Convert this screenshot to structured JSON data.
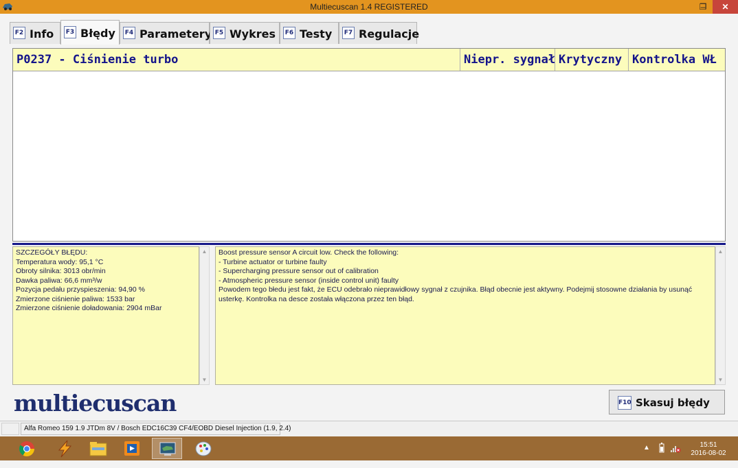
{
  "window": {
    "title": "Multiecuscan 1.4 REGISTERED",
    "minimize": "–",
    "maximize": "❐",
    "close": "✕"
  },
  "tabs": [
    {
      "key": "F2",
      "label": "Info",
      "active": false
    },
    {
      "key": "F3",
      "label": "Błędy",
      "active": true
    },
    {
      "key": "F4",
      "label": "Parametery",
      "active": false
    },
    {
      "key": "F5",
      "label": "Wykres",
      "active": false
    },
    {
      "key": "F6",
      "label": "Testy",
      "active": false
    },
    {
      "key": "F7",
      "label": "Regulacje",
      "active": false
    }
  ],
  "errors": {
    "row": {
      "code_desc": "P0237 - Ciśnienie turbo",
      "col1": "Niepr. sygnał",
      "col2": "Krytyczny",
      "col3": "Kontrolka WŁ"
    }
  },
  "details": {
    "left": [
      "SZCZEGÓŁY BŁĘDU:",
      "Temperatura wody: 95,1 °C",
      "Obroty silnika: 3013 obr/min",
      "Dawka paliwa: 66,6 mm³/w",
      "Pozycja pedału przyspieszenia: 94,90 %",
      "Zmierzone ciśnienie paliwa: 1533 bar",
      "Zmierzone ciśnienie doładowania: 2904 mBar"
    ],
    "right": [
      "Boost pressure sensor A circuit low. Check the following:",
      "- Turbine actuator or turbine faulty",
      "- Supercharging pressure sensor out of calibration",
      "- Atmospheric pressure sensor (inside control unit) faulty",
      "Powodem tego błedu jest fakt, że ECU odebrało nieprawidłowy sygnał z czujnika. Błąd obecnie jest aktywny. Podejmij stosowne działania by usunąć usterkę. Kontrolka na desce została włączona przez ten błąd."
    ]
  },
  "logo": "multiecuscan",
  "clear_button": {
    "key": "F10",
    "label": "Skasuj błędy"
  },
  "status": {
    "vehicle": "Alfa Romeo 159 1.9 JTDm 8V / Bosch EDC16C39 CF4/EOBD Diesel Injection (1.9, 2.4)"
  },
  "taskbar": {
    "items": [
      "chrome-icon",
      "lightning-app-icon",
      "file-explorer-icon",
      "media-player-icon",
      "multiecuscan-icon",
      "paint-icon"
    ],
    "time": "15:51",
    "date": "2016-08-02"
  }
}
